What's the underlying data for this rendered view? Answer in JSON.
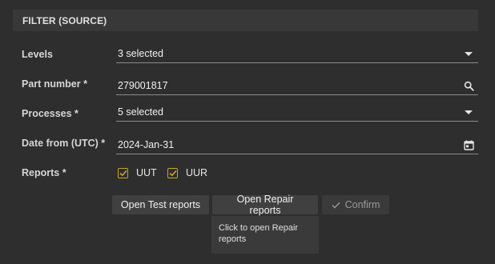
{
  "panel": {
    "title": "FILTER (SOURCE)"
  },
  "fields": {
    "levels": {
      "label": "Levels",
      "value": "3 selected",
      "icon": "chevron-down-icon"
    },
    "part_number": {
      "label": "Part number *",
      "value": "279001817",
      "icon": "search-icon"
    },
    "processes": {
      "label": "Processes *",
      "value": "5 selected",
      "icon": "chevron-down-icon"
    },
    "date_from": {
      "label": "Date from (UTC) *",
      "value": "2024-Jan-31",
      "icon": "calendar-icon"
    }
  },
  "reports": {
    "label": "Reports *",
    "options": [
      {
        "label": "UUT",
        "checked": true
      },
      {
        "label": "UUR",
        "checked": true
      }
    ]
  },
  "actions": {
    "open_test_reports": "Open Test reports",
    "open_repair_reports": "Open Repair reports",
    "confirm": "Confirm"
  },
  "tooltip": {
    "text": "Click to open Repair reports"
  },
  "colors": {
    "background": "#2e2e2e",
    "header": "#383838",
    "accent": "#c9a227",
    "underline": "#8a8a8a"
  }
}
